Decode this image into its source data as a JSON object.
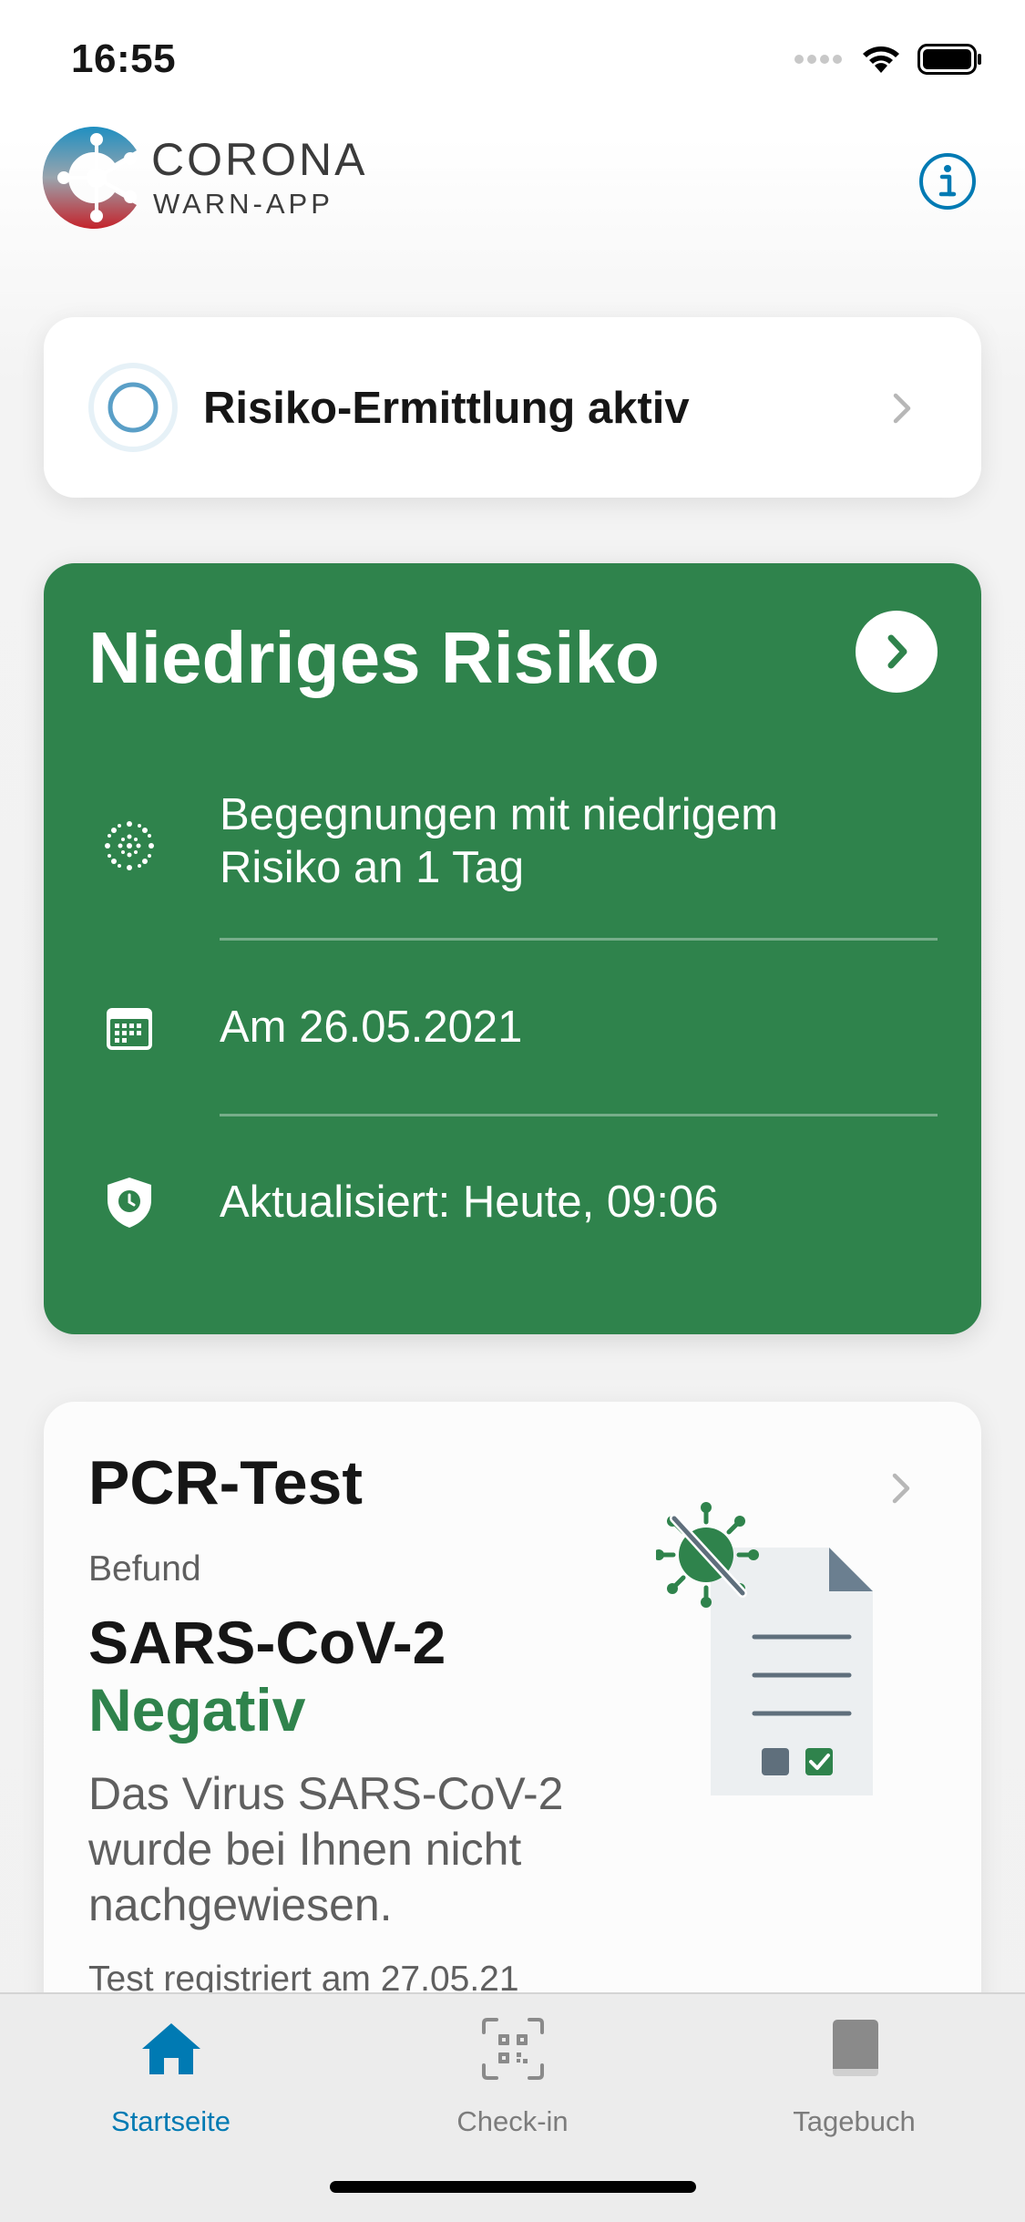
{
  "status_bar": {
    "time": "16:55"
  },
  "header": {
    "app_name_line1": "CORONA",
    "app_name_line2": "WARN-APP"
  },
  "status_card": {
    "label": "Risiko-Ermittlung aktiv"
  },
  "risk_card": {
    "title": "Niedriges Risiko",
    "rows": [
      {
        "icon": "virus-dots-icon",
        "text_line1": "Begegnungen mit niedrigem",
        "text_line2": "Risiko an 1 Tag"
      },
      {
        "icon": "calendar-icon",
        "text": "Am 26.05.2021"
      },
      {
        "icon": "shield-clock-icon",
        "text": "Aktualisiert: Heute, 09:06"
      }
    ]
  },
  "test_card": {
    "title": "PCR-Test",
    "befund_label": "Befund",
    "virus": "SARS-CoV-2",
    "result": "Negativ",
    "description": "Das Virus SARS-CoV-2 wurde bei Ihnen nicht nachgewiesen.",
    "registered": "Test registriert am 27.05.21"
  },
  "tabbar": {
    "tabs": [
      {
        "label": "Startseite",
        "icon": "home-icon",
        "active": true
      },
      {
        "label": "Check-in",
        "icon": "qr-code-icon",
        "active": false
      },
      {
        "label": "Tagebuch",
        "icon": "book-icon",
        "active": false
      }
    ]
  },
  "colors": {
    "risk_green": "#2f834c",
    "accent_blue": "#007ab3",
    "negative_green": "#2f834c"
  }
}
